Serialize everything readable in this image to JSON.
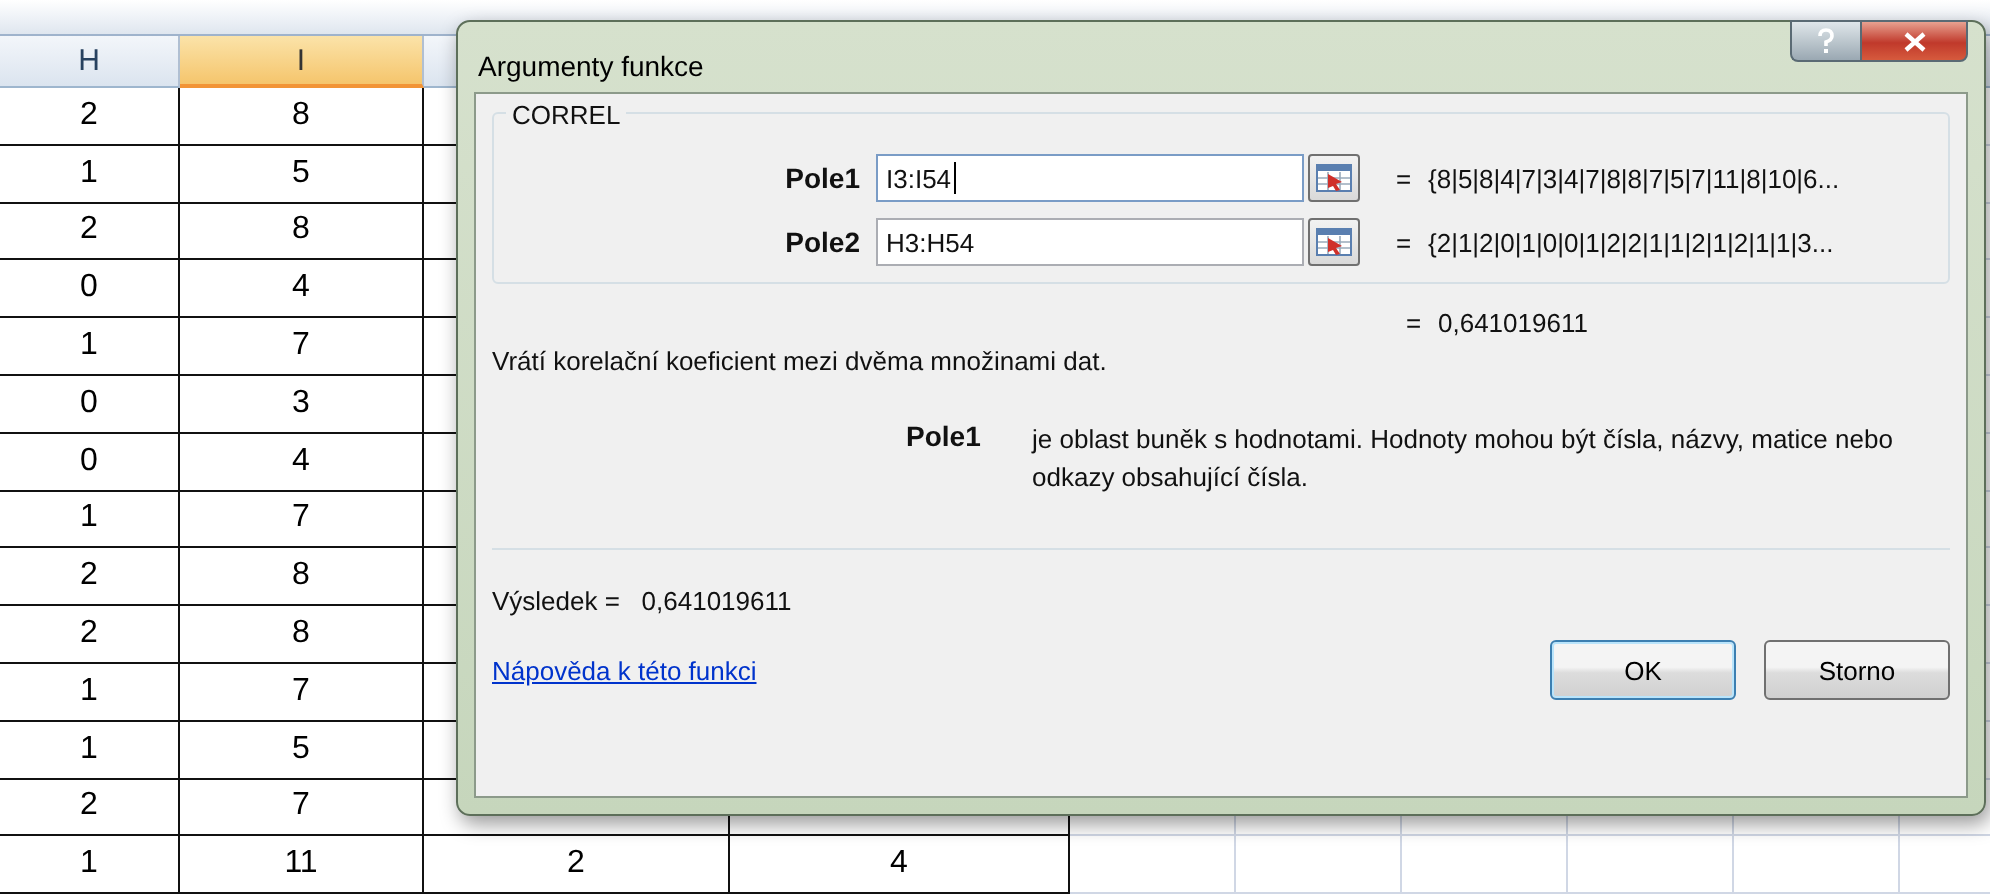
{
  "spreadsheet": {
    "columns": [
      {
        "label": "H",
        "selected": false
      },
      {
        "label": "I",
        "selected": true
      }
    ],
    "rows": [
      [
        "2",
        "8"
      ],
      [
        "1",
        "5"
      ],
      [
        "2",
        "8"
      ],
      [
        "0",
        "4"
      ],
      [
        "1",
        "7"
      ],
      [
        "0",
        "3"
      ],
      [
        "0",
        "4"
      ],
      [
        "1",
        "7"
      ],
      [
        "2",
        "8"
      ],
      [
        "2",
        "8"
      ],
      [
        "1",
        "7"
      ],
      [
        "1",
        "5"
      ],
      [
        "2",
        "7"
      ],
      [
        "1",
        "11",
        "2",
        "4"
      ]
    ]
  },
  "dialog": {
    "title": "Argumenty funkce",
    "function_name": "CORREL",
    "arguments": [
      {
        "label": "Pole1",
        "value": "I3:I54",
        "focused": true,
        "equals": "=",
        "preview": "{8|5|8|4|7|3|4|7|8|8|7|5|7|11|8|10|6..."
      },
      {
        "label": "Pole2",
        "value": "H3:H54",
        "focused": false,
        "equals": "=",
        "preview": "{2|1|2|0|1|0|0|1|2|2|1|1|2|1|2|1|1|3..."
      }
    ],
    "result_preview": {
      "equals": "=",
      "value": "0,641019611"
    },
    "description": "Vrátí korelační koeficient mezi dvěma množinami dat.",
    "argument_help": {
      "label": "Pole1",
      "text": "je oblast buněk s hodnotami. Hodnoty mohou být čísla, názvy, matice nebo odkazy obsahující čísla."
    },
    "result_label": "Výsledek =",
    "result": "0,641019611",
    "help_link": "Nápověda k této funkci",
    "buttons": [
      {
        "label": "OK",
        "default": true
      },
      {
        "label": "Storno",
        "default": false
      }
    ]
  }
}
